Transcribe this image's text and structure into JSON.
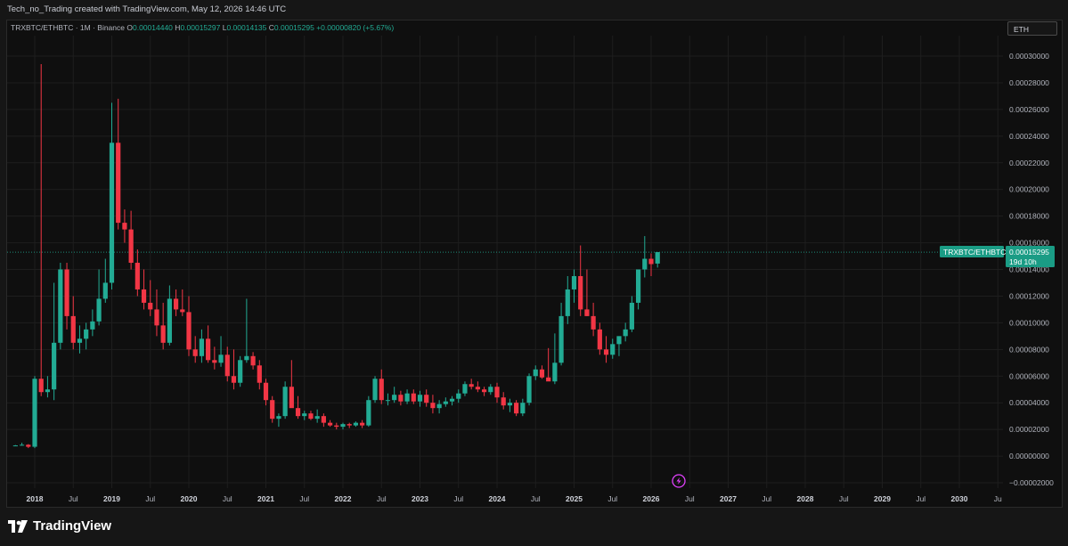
{
  "header": {
    "credit": "Tech_no_Trading created with TradingView.com, May 12, 2026 14:46 UTC"
  },
  "legend": {
    "symbol": "TRXBTC/ETHBTC · 1M · Binance",
    "open_label": "O",
    "open": "0.00014440",
    "high_label": "H",
    "high": "0.00015297",
    "low_label": "L",
    "low": "0.00014135",
    "close_label": "C",
    "close": "0.00015295",
    "change": "+0.00000820 (+5.67%)"
  },
  "symbol_search": {
    "value": "ETH"
  },
  "price_tag": {
    "name": "TRXBTC/ETHBTC",
    "price": "0.00015295",
    "countdown": "19d 10h"
  },
  "footer": {
    "brand": "TradingView"
  },
  "colors": {
    "up": "#22ab94",
    "down": "#f23645",
    "bg": "#0f0f0f",
    "grid": "#1e1e1e",
    "tag": "#1a9c85"
  },
  "chart_data": {
    "type": "candlestick",
    "interval": "1M",
    "ylim": [
      -2e-05,
      3e-05
    ],
    "y_ticks": [
      "0.00030000",
      "0.00028000",
      "0.00026000",
      "0.00024000",
      "0.00022000",
      "0.00020000",
      "0.00018000",
      "0.00016000",
      "0.00014000",
      "0.00012000",
      "0.00010000",
      "0.00008000",
      "0.00006000",
      "0.00004000",
      "0.00002000",
      "0.00000000",
      "−0.00002000"
    ],
    "y_tick_values": [
      0.0003,
      0.00028,
      0.00026,
      0.00024,
      0.00022,
      0.0002,
      0.00018,
      0.00016,
      0.00014,
      0.00012,
      0.0001,
      8e-05,
      6e-05,
      4e-05,
      2e-05,
      0.0,
      -2e-05
    ],
    "x_ticks": [
      {
        "label": "2018",
        "year": true,
        "pos": 2018.0
      },
      {
        "label": "Jul",
        "year": false,
        "pos": 2018.5
      },
      {
        "label": "2019",
        "year": true,
        "pos": 2019.0
      },
      {
        "label": "Jul",
        "year": false,
        "pos": 2019.5
      },
      {
        "label": "2020",
        "year": true,
        "pos": 2020.0
      },
      {
        "label": "Jul",
        "year": false,
        "pos": 2020.5
      },
      {
        "label": "2021",
        "year": true,
        "pos": 2021.0
      },
      {
        "label": "Jul",
        "year": false,
        "pos": 2021.5
      },
      {
        "label": "2022",
        "year": true,
        "pos": 2022.0
      },
      {
        "label": "Jul",
        "year": false,
        "pos": 2022.5
      },
      {
        "label": "2023",
        "year": true,
        "pos": 2023.0
      },
      {
        "label": "Jul",
        "year": false,
        "pos": 2023.5
      },
      {
        "label": "2024",
        "year": true,
        "pos": 2024.0
      },
      {
        "label": "Jul",
        "year": false,
        "pos": 2024.5
      },
      {
        "label": "2025",
        "year": true,
        "pos": 2025.0
      },
      {
        "label": "Jul",
        "year": false,
        "pos": 2025.5
      },
      {
        "label": "2026",
        "year": true,
        "pos": 2026.0
      },
      {
        "label": "Jul",
        "year": false,
        "pos": 2026.5
      },
      {
        "label": "2027",
        "year": true,
        "pos": 2027.0
      },
      {
        "label": "Jul",
        "year": false,
        "pos": 2027.5
      },
      {
        "label": "2028",
        "year": true,
        "pos": 2028.0
      },
      {
        "label": "Jul",
        "year": false,
        "pos": 2028.5
      },
      {
        "label": "2029",
        "year": true,
        "pos": 2029.0
      },
      {
        "label": "Jul",
        "year": false,
        "pos": 2029.5
      },
      {
        "label": "2030",
        "year": true,
        "pos": 2030.0
      },
      {
        "label": "Ju",
        "year": false,
        "pos": 2030.5
      }
    ],
    "last_price": 0.00015295,
    "candles": [
      [
        7.7e-06,
        8.3e-06,
        7.8e-06,
        8e-06
      ],
      [
        8e-06,
        1e-05,
        7.8e-06,
        8.5e-06
      ],
      [
        8.5e-06,
        9e-06,
        6e-06,
        7e-06
      ],
      [
        7e-06,
        6e-05,
        6e-06,
        5.8e-05
      ],
      [
        5.8e-05,
        0.000294,
        4.5e-05,
        4.8e-05
      ],
      [
        4.8e-05,
        6e-05,
        4.4e-05,
        5e-05
      ],
      [
        5e-05,
        0.00013,
        4.2e-05,
        8.5e-05
      ],
      [
        8.5e-05,
        0.000145,
        8e-05,
        0.00014
      ],
      [
        0.00014,
        0.000145,
        9.5e-05,
        0.000105
      ],
      [
        0.000105,
        0.00012,
        8e-05,
        8.5e-05
      ],
      [
        8.5e-05,
        9.8e-05,
        7.7e-05,
        8.8e-05
      ],
      [
        8.8e-05,
        0.0001,
        8e-05,
        9.5e-05
      ],
      [
        9.5e-05,
        0.00011,
        9e-05,
        0.000101
      ],
      [
        0.000101,
        0.00014,
        9.8e-05,
        0.000118
      ],
      [
        0.000118,
        0.000148,
        0.000115,
        0.00013
      ],
      [
        0.00013,
        0.000265,
        0.000125,
        0.000235
      ],
      [
        0.000235,
        0.000268,
        0.00017,
        0.000175
      ],
      [
        0.000175,
        0.000185,
        0.00016,
        0.00017
      ],
      [
        0.00017,
        0.000184,
        0.00014,
        0.000145
      ],
      [
        0.000145,
        0.000155,
        0.00012,
        0.000125
      ],
      [
        0.000125,
        0.00014,
        0.00011,
        0.000115
      ],
      [
        0.000115,
        0.000132,
        0.000105,
        0.00011
      ],
      [
        0.00011,
        0.000125,
        9e-05,
        9.8e-05
      ],
      [
        9.8e-05,
        0.000115,
        8e-05,
        8.5e-05
      ],
      [
        8.5e-05,
        0.000128,
        8.3e-05,
        0.000118
      ],
      [
        0.000118,
        0.000125,
        0.000105,
        0.00011
      ],
      [
        0.00011,
        0.000125,
        0.000105,
        0.000108
      ],
      [
        0.000108,
        0.00012,
        7.5e-05,
        8e-05
      ],
      [
        8e-05,
        9e-05,
        7e-05,
        7.5e-05
      ],
      [
        7.5e-05,
        9.5e-05,
        7e-05,
        8.8e-05
      ],
      [
        8.8e-05,
        9.8e-05,
        7e-05,
        7.2e-05
      ],
      [
        7.2e-05,
        8.2e-05,
        6.5e-05,
        7e-05
      ],
      [
        7e-05,
        9e-05,
        6.7e-05,
        7.6e-05
      ],
      [
        7.6e-05,
        8.2e-05,
        5.6e-05,
        6e-05
      ],
      [
        6e-05,
        8e-05,
        5e-05,
        5.5e-05
      ],
      [
        5.5e-05,
        7.5e-05,
        5.2e-05,
        7.2e-05
      ],
      [
        7.2e-05,
        0.000118,
        7e-05,
        7.5e-05
      ],
      [
        7.5e-05,
        7.8e-05,
        6.5e-05,
        6.8e-05
      ],
      [
        6.8e-05,
        7.2e-05,
        5e-05,
        5.5e-05
      ],
      [
        5.5e-05,
        5.8e-05,
        3.8e-05,
        4.2e-05
      ],
      [
        4.2e-05,
        4.5e-05,
        2.5e-05,
        2.8e-05
      ],
      [
        2.8e-05,
        3.2e-05,
        2.2e-05,
        3e-05
      ],
      [
        3e-05,
        5.6e-05,
        2.8e-05,
        5.2e-05
      ],
      [
        5.2e-05,
        7.2e-05,
        5e-05,
        3.6e-05
      ],
      [
        3.6e-05,
        4.5e-05,
        2.8e-05,
        3e-05
      ],
      [
        3e-05,
        3.4e-05,
        2.7e-05,
        3.2e-05
      ],
      [
        3.2e-05,
        3.4e-05,
        2.7e-05,
        2.8e-05
      ],
      [
        2.8e-05,
        3.5e-05,
        2.5e-05,
        3e-05
      ],
      [
        3e-05,
        3.2e-05,
        2.2e-05,
        2.5e-05
      ],
      [
        2.5e-05,
        2.7e-05,
        2.2e-05,
        2.3e-05
      ],
      [
        2.3e-05,
        2.5e-05,
        2e-05,
        2.2e-05
      ],
      [
        2.2e-05,
        2.5e-05,
        2e-05,
        2.4e-05
      ],
      [
        2.4e-05,
        2.5e-05,
        2.1e-05,
        2.3e-05
      ],
      [
        2.3e-05,
        2.6e-05,
        2.2e-05,
        2.5e-05
      ],
      [
        2.5e-05,
        2.7e-05,
        2.1e-05,
        2.3e-05
      ],
      [
        2.3e-05,
        4.5e-05,
        2.2e-05,
        4.2e-05
      ],
      [
        4.2e-05,
        6e-05,
        4e-05,
        5.8e-05
      ],
      [
        5.8e-05,
        6.5e-05,
        3.9e-05,
        4.2e-05
      ],
      [
        4.2e-05,
        4.7e-05,
        3.8e-05,
        4.2e-05
      ],
      [
        4.2e-05,
        5.2e-05,
        4e-05,
        4.6e-05
      ],
      [
        4.6e-05,
        4.9e-05,
        3.8e-05,
        4.1e-05
      ],
      [
        4.1e-05,
        5e-05,
        3.9e-05,
        4.7e-05
      ],
      [
        4.7e-05,
        5e-05,
        3.9e-05,
        4.1e-05
      ],
      [
        4.1e-05,
        4.9e-05,
        3.7e-05,
        4.6e-05
      ],
      [
        4.6e-05,
        5e-05,
        3.7e-05,
        4e-05
      ],
      [
        4e-05,
        4.6e-05,
        3.2e-05,
        3.6e-05
      ],
      [
        3.6e-05,
        4.2e-05,
        3.2e-05,
        3.9e-05
      ],
      [
        3.9e-05,
        4.4e-05,
        3.7e-05,
        4.1e-05
      ],
      [
        4.1e-05,
        4.5e-05,
        3.8e-05,
        4.3e-05
      ],
      [
        4.3e-05,
        5e-05,
        4e-05,
        4.7e-05
      ],
      [
        4.7e-05,
        5.6e-05,
        4.5e-05,
        5.4e-05
      ],
      [
        5.4e-05,
        5.8e-05,
        5e-05,
        5.2e-05
      ],
      [
        5.2e-05,
        5.6e-05,
        4.8e-05,
        5e-05
      ],
      [
        5e-05,
        5.2e-05,
        4.5e-05,
        4.8e-05
      ],
      [
        4.8e-05,
        5.4e-05,
        4.6e-05,
        5.2e-05
      ],
      [
        5.2e-05,
        5.5e-05,
        4e-05,
        4.4e-05
      ],
      [
        4.4e-05,
        4.8e-05,
        3.5e-05,
        3.8e-05
      ],
      [
        3.8e-05,
        4.3e-05,
        3.3e-05,
        4e-05
      ],
      [
        4e-05,
        4.2e-05,
        3e-05,
        3.2e-05
      ],
      [
        3.2e-05,
        4.3e-05,
        3e-05,
        4e-05
      ],
      [
        4e-05,
        6.2e-05,
        3.8e-05,
        6e-05
      ],
      [
        6e-05,
        6.8e-05,
        5.7e-05,
        6.5e-05
      ],
      [
        6.5e-05,
        6.8e-05,
        5.8e-05,
        5.9e-05
      ],
      [
        5.9e-05,
        8.1e-05,
        5.7e-05,
        5.6e-05
      ],
      [
        5.6e-05,
        9.2e-05,
        5.4e-05,
        7e-05
      ],
      [
        7e-05,
        0.000115,
        6.8e-05,
        0.000105
      ],
      [
        0.000105,
        0.000135,
        9.9e-05,
        0.000125
      ],
      [
        0.000125,
        0.00014,
        0.000115,
        0.000135
      ],
      [
        0.000135,
        0.000158,
        0.000105,
        0.00011
      ],
      [
        0.00011,
        0.00014,
        0.000105,
        0.000105
      ],
      [
        0.000105,
        0.000115,
        9e-05,
        9.5e-05
      ],
      [
        9.5e-05,
        0.0001,
        7.6e-05,
        8e-05
      ],
      [
        8e-05,
        9e-05,
        7e-05,
        7.6e-05
      ],
      [
        7.6e-05,
        8.8e-05,
        7.3e-05,
        8.4e-05
      ],
      [
        8.4e-05,
        8.8e-05,
        7.5e-05,
        9e-05
      ],
      [
        9e-05,
        0.0001,
        8.6e-05,
        9.5e-05
      ],
      [
        9.5e-05,
        0.00012,
        9.3e-05,
        0.000115
      ],
      [
        0.000115,
        0.000138,
        0.00011,
        0.00014
      ],
      [
        0.00014,
        0.000165,
        0.000134,
        0.000148
      ],
      [
        0.000148,
        0.000152,
        0.000135,
        0.000144
      ],
      [
        0.0001444,
        0.000153,
        0.0001414,
        0.000153
      ]
    ]
  }
}
